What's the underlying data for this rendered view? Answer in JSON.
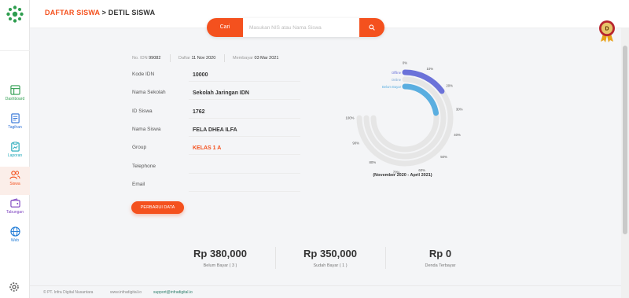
{
  "sidebar": {
    "items": [
      {
        "label": "Dashboard",
        "icon": "dashboard-icon"
      },
      {
        "label": "Tagihan",
        "icon": "invoice-icon"
      },
      {
        "label": "Laporan",
        "icon": "report-icon"
      },
      {
        "label": "Siswa",
        "icon": "users-icon",
        "active": true
      },
      {
        "label": "Tabungan",
        "icon": "wallet-icon"
      },
      {
        "label": "Web",
        "icon": "globe-icon"
      }
    ]
  },
  "breadcrumb": {
    "parent": "DAFTAR SISWA",
    "separator": ">",
    "current": "DETIL SISWA"
  },
  "search": {
    "button_label": "Cari",
    "placeholder": "Masukan NIS atau Nama Siswa"
  },
  "profile_badge": {
    "initial": "D"
  },
  "meta": {
    "no_idn_label": "No. IDN",
    "no_idn_value": "99082",
    "daftar_label": "Daftar",
    "daftar_value": "11 Nov 2020",
    "membayar_label": "Membayar",
    "membayar_value": "03 Mar 2021"
  },
  "fields": [
    {
      "label": "Kode IDN",
      "value": "10000"
    },
    {
      "label": "Nama Sekolah",
      "value": "Sekolah Jaringan IDN"
    },
    {
      "label": "ID Siswa",
      "value": "1762"
    },
    {
      "label": "Nama Siswa",
      "value": "FELA DHEA ILFA"
    },
    {
      "label": "Group",
      "value": "KELAS 1 A"
    },
    {
      "label": "Telephone",
      "value": ""
    },
    {
      "label": "Email",
      "value": ""
    }
  ],
  "update_button": "PERBARUI DATA",
  "chart_data": {
    "type": "radial-bar",
    "series": [
      {
        "name": "Offline",
        "value": 20
      },
      {
        "name": "Online",
        "value": 0
      },
      {
        "name": "Belum Bayar",
        "value": 30
      }
    ],
    "scale_labels": [
      "0%",
      "10%",
      "20%",
      "30%",
      "40%",
      "50%",
      "60%",
      "70%",
      "80%",
      "90%",
      "100%"
    ],
    "range": [
      0,
      100
    ],
    "caption": "(November 2020 - April 2021)",
    "colors": {
      "Offline": "#6b72d9",
      "Online": "#c9c9c9",
      "Belum Bayar": "#5aaee0",
      "track": "#e6e6e6"
    }
  },
  "summary": [
    {
      "value": "Rp 380,000",
      "label": "Belum Bayar ( 3 )"
    },
    {
      "value": "Rp 350,000",
      "label": "Sudah Bayar ( 1 )"
    },
    {
      "value": "Rp 0",
      "label": "Denda Terbayar"
    }
  ],
  "footer": {
    "copyright": "© PT. Infra Digital Nusantara",
    "website": "www.infradigital.io",
    "email": "support@infradigital.io"
  },
  "colors": {
    "accent": "#f4511e",
    "brand": "#2e9d4f"
  }
}
